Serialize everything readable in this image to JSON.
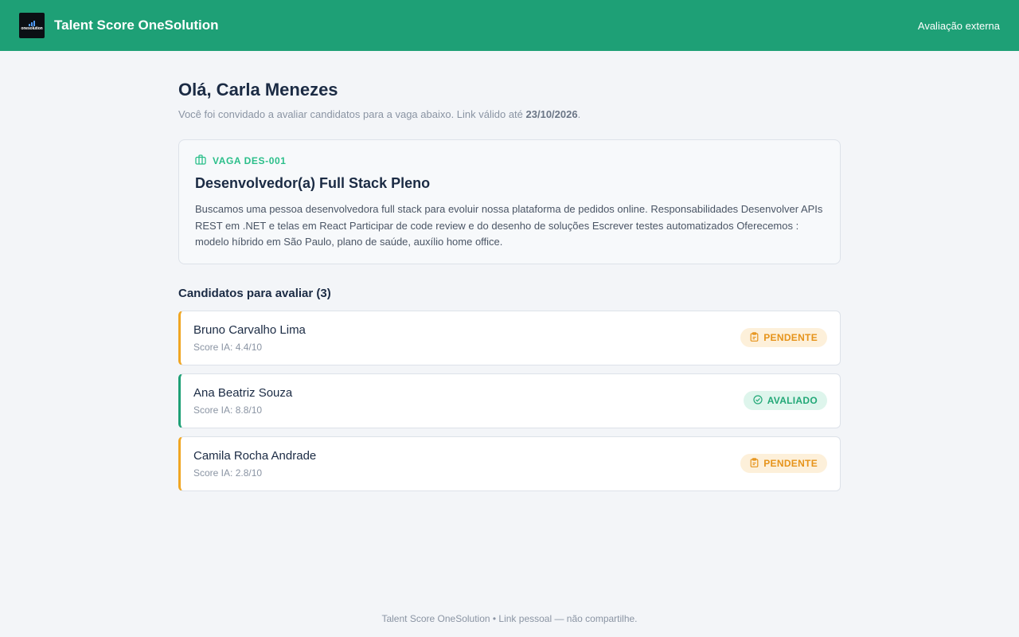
{
  "header": {
    "logo_text": "onesolution",
    "app_title": "Talent Score OneSolution",
    "right_text": "Avaliação externa"
  },
  "greeting": {
    "title": "Olá, Carla Menezes",
    "subtitle_prefix": "Você foi convidado a avaliar candidatos para a vaga abaixo. Link válido até ",
    "valid_until": "23/10/2026",
    "subtitle_suffix": "."
  },
  "job": {
    "icon": "briefcase-icon",
    "code": "VAGA DES-001",
    "title": "Desenvolvedor(a) Full Stack Pleno",
    "description": "Buscamos uma pessoa desenvolvedora full stack para evoluir nossa plataforma de pedidos online. Responsabilidades Desenvolver APIs REST em .NET e telas em React Participar de code review e do desenho de soluções Escrever testes automatizados Oferecemos : modelo híbrido em São Paulo, plano de saúde, auxílio home office."
  },
  "candidates_section": {
    "title": "Candidatos para avaliar (3)",
    "items": [
      {
        "name": "Bruno Carvalho Lima",
        "score": "Score IA: 4.4/10",
        "status": "PENDENTE",
        "status_icon": "clipboard-icon"
      },
      {
        "name": "Ana Beatriz Souza",
        "score": "Score IA: 8.8/10",
        "status": "AVALIADO",
        "status_icon": "check-circle-icon"
      },
      {
        "name": "Camila Rocha Andrade",
        "score": "Score IA: 2.8/10",
        "status": "PENDENTE",
        "status_icon": "clipboard-icon"
      }
    ]
  },
  "footer": {
    "text": "Talent Score OneSolution • Link pessoal — não compartilhe."
  },
  "colors": {
    "header": "#1ea076",
    "pending": "#f0a623",
    "done": "#1ea076",
    "background": "#f3f5f8"
  }
}
